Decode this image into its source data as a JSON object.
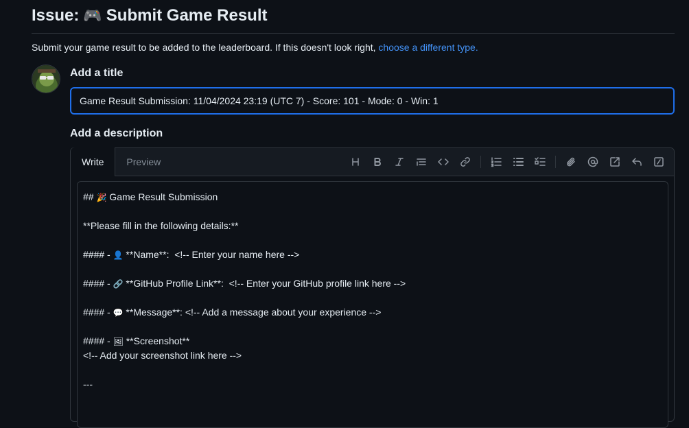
{
  "header": {
    "title_prefix": "Issue:",
    "title_icon": "🎮",
    "title_text": "Submit Game Result"
  },
  "intro": {
    "text": "Submit your game result to be added to the leaderboard. If this doesn't look right,",
    "link": "choose a different type."
  },
  "form": {
    "title_label": "Add a title",
    "title_value": "Game Result Submission: 11/04/2024 23:19 (UTC 7) - Score: 101 - Mode: 0 - Win: 1",
    "description_label": "Add a description"
  },
  "editor": {
    "tabs": [
      "Write",
      "Preview"
    ],
    "active_tab": "Write",
    "toolbar_icons": [
      "heading-icon",
      "bold-icon",
      "italic-icon",
      "quote-icon",
      "code-icon",
      "link-icon",
      "ordered-list-icon",
      "unordered-list-icon",
      "task-list-icon",
      "attach-icon",
      "mention-icon",
      "reference-icon",
      "reply-icon",
      "slash-command-icon"
    ],
    "lines": [
      {
        "a": "## ",
        "emoji": "🎉",
        "b": " Game Result Submission"
      },
      {
        "a": "",
        "emoji": "",
        "b": ""
      },
      {
        "a": "**Please fill in the following details:**",
        "emoji": "",
        "b": ""
      },
      {
        "a": "",
        "emoji": "",
        "b": ""
      },
      {
        "a": "#### - ",
        "emoji": "👤",
        "b": " **Name**:  <!-- Enter your name here -->"
      },
      {
        "a": "",
        "emoji": "",
        "b": ""
      },
      {
        "a": "#### - ",
        "emoji": "🔗",
        "b": " **GitHub Profile Link**:  <!-- Enter your GitHub profile link here -->"
      },
      {
        "a": "",
        "emoji": "",
        "b": ""
      },
      {
        "a": "#### - ",
        "emoji": "💬",
        "b": " **Message**: <!-- Add a message about your experience -->"
      },
      {
        "a": "",
        "emoji": "",
        "b": ""
      },
      {
        "a": "#### - ",
        "emoji": "🖼",
        "b": " **Screenshot**"
      },
      {
        "a": "<!-- Add your screenshot link here -->",
        "emoji": "",
        "b": ""
      },
      {
        "a": "",
        "emoji": "",
        "b": ""
      },
      {
        "a": "---",
        "emoji": "",
        "b": ""
      }
    ]
  }
}
